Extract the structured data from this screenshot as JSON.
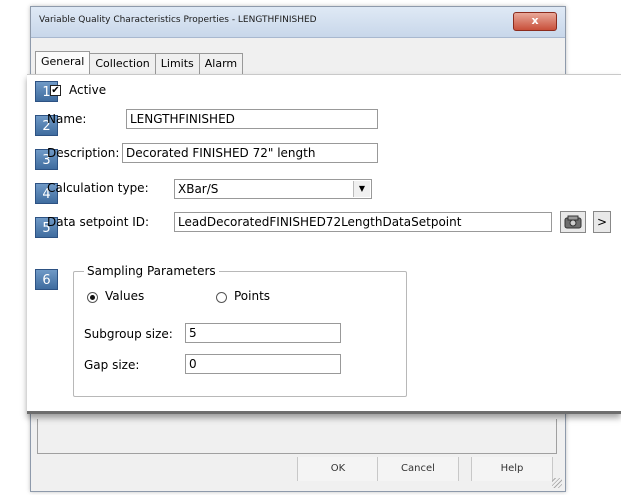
{
  "window": {
    "title": "Variable Quality Characteristics Properties - LENGTHFINISHED",
    "close_label": "x"
  },
  "tabs": [
    {
      "label": "General",
      "active": true
    },
    {
      "label": "Collection",
      "active": false
    },
    {
      "label": "Limits",
      "active": false
    },
    {
      "label": "Alarm",
      "active": false
    }
  ],
  "badges": [
    "1",
    "2",
    "3",
    "4",
    "5",
    "6"
  ],
  "form": {
    "active_label": "Active",
    "active_checked": true,
    "name_label": "Name:",
    "name_value": "LENGTHFINISHED",
    "description_label": "Description:",
    "description_value": "Decorated FINISHED 72\" length",
    "calc_type_label": "Calculation type:",
    "calc_type_value": "XBar/S",
    "setpoint_label": "Data setpoint ID:",
    "setpoint_value": "LeadDecoratedFINISHED72LengthDataSetpoint",
    "browse_icon": "setpoint-browse-icon",
    "more_label": ">"
  },
  "sampling": {
    "title": "Sampling Parameters",
    "values_label": "Values",
    "points_label": "Points",
    "selected": "Values",
    "subgroup_label": "Subgroup size:",
    "subgroup_value": "5",
    "gap_label": "Gap size:",
    "gap_value": "0"
  },
  "buttons": {
    "ok": "OK",
    "cancel": "Cancel",
    "help": "Help"
  },
  "colors": {
    "badge": "#4f7db1",
    "close": "#c84f3a"
  }
}
